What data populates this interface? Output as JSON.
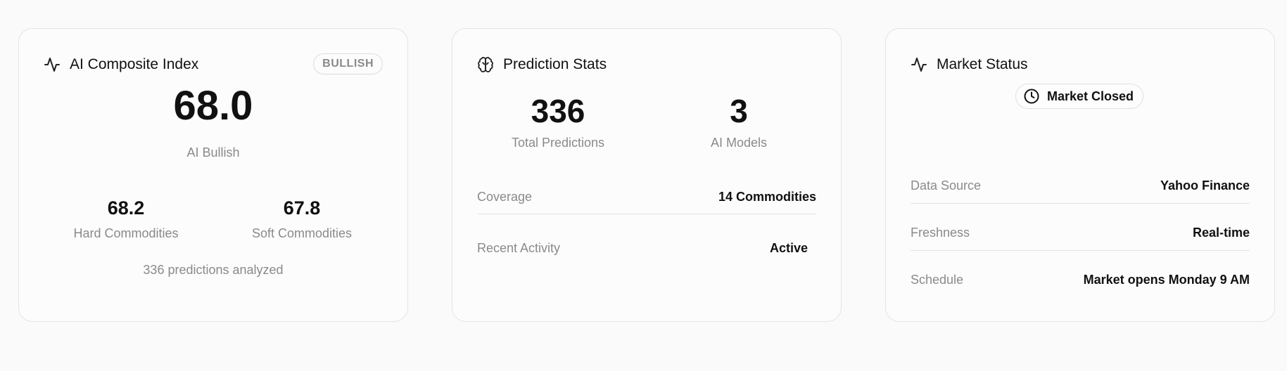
{
  "composite": {
    "title": "AI Composite Index",
    "badge": "BULLISH",
    "value": "68.0",
    "label": "AI Bullish",
    "hard": {
      "value": "68.2",
      "label": "Hard Commodities"
    },
    "soft": {
      "value": "67.8",
      "label": "Soft Commodities"
    },
    "footer": "336 predictions analyzed"
  },
  "prediction": {
    "title": "Prediction Stats",
    "total": {
      "value": "336",
      "label": "Total Predictions"
    },
    "models": {
      "value": "3",
      "label": "AI Models"
    },
    "rows": [
      {
        "key": "Coverage",
        "value": "14 Commodities"
      },
      {
        "key": "Recent Activity",
        "value": "Active"
      }
    ]
  },
  "market": {
    "title": "Market Status",
    "status": "Market Closed",
    "rows": [
      {
        "key": "Data Source",
        "value": "Yahoo Finance"
      },
      {
        "key": "Freshness",
        "value": "Real-time"
      },
      {
        "key": "Schedule",
        "value": "Market opens Monday 9 AM"
      }
    ]
  },
  "icons": {
    "composite": "activity-icon",
    "prediction": "brain-icon",
    "market": "activity-icon",
    "status": "clock-icon"
  }
}
